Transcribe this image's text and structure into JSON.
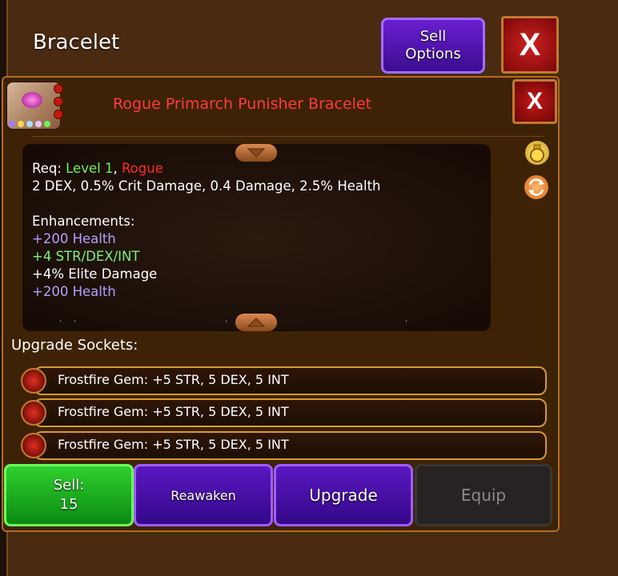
{
  "header": {
    "title": "Bracelet",
    "sell_options_label": "Sell Options",
    "close_label": "X"
  },
  "item": {
    "name": "Rogue Primarch Punisher Bracelet",
    "close_label": "X",
    "rarity_dots": [
      "#9f7cff",
      "#ffd84a",
      "#a0e0ff",
      "#e6c8ff",
      "#6cf05c"
    ]
  },
  "description": {
    "req_prefix": "Req: ",
    "req_level": "Level 1",
    "req_sep": ", ",
    "req_class": "Rogue",
    "stats": "2 DEX, 0.5% Crit Damage, 0.4 Damage, 2.5% Health",
    "enhancements_title": "Enhancements:",
    "enhancements": [
      {
        "text": "+200 Health",
        "color": "purple"
      },
      {
        "text": "+4 STR/DEX/INT",
        "color": "green"
      },
      {
        "text": "+4% Elite Damage",
        "color": "white"
      },
      {
        "text": "+200 Health",
        "color": "purple"
      }
    ]
  },
  "sockets": {
    "label": "Upgrade Sockets:",
    "items": [
      {
        "text": "Frostfire Gem: +5 STR, 5 DEX, 5 INT"
      },
      {
        "text": "Frostfire Gem: +5 STR, 5 DEX, 5 INT"
      },
      {
        "text": "Frostfire Gem: +5 STR, 5 DEX, 5 INT"
      }
    ]
  },
  "actions": {
    "sell_label": "Sell:",
    "sell_value": "15",
    "reawaken_label": "Reawaken",
    "upgrade_label": "Upgrade",
    "equip_label": "Equip"
  },
  "colors": {
    "background": "#4a2a10",
    "panel": "#3e2206",
    "item_name": "#ff3b3b",
    "sell_button": "#1fae20",
    "purple_button": "#4a12a8",
    "equip_disabled": "#262322"
  }
}
